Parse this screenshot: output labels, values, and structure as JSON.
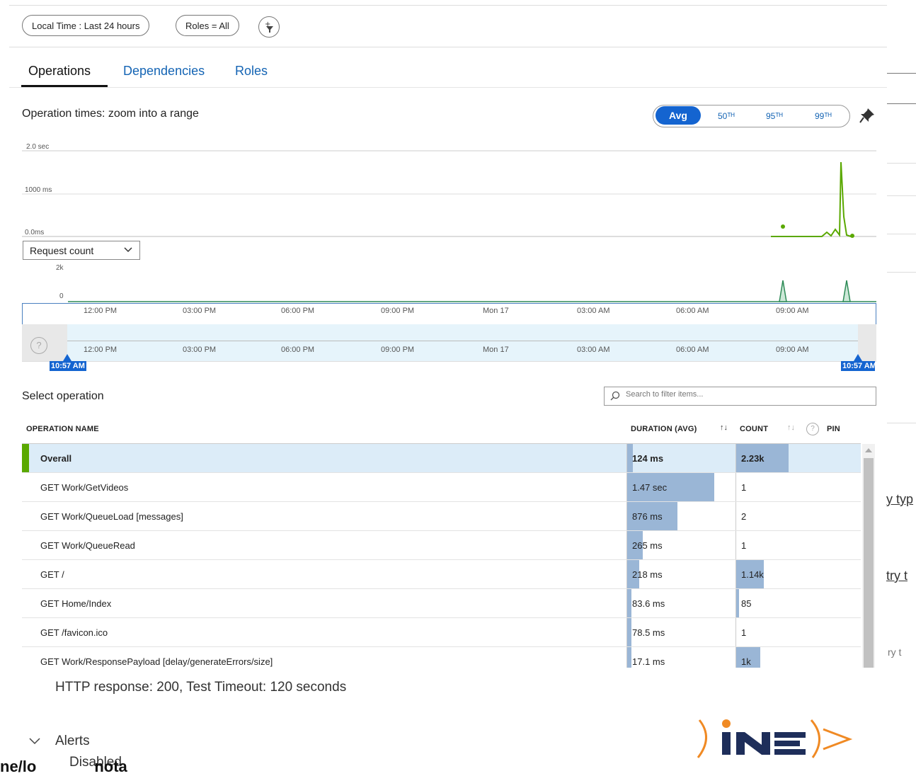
{
  "filters": {
    "time": "Local Time : Last 24 hours",
    "roles": "Roles = All",
    "add_filter_icon": "add-filter-icon"
  },
  "tabs": [
    "Operations",
    "Dependencies",
    "Roles"
  ],
  "chart_title": "Operation times: zoom into a range",
  "percentile": {
    "avg": "Avg",
    "p50": "50ᵀᴴ",
    "p95": "95ᵀᴴ",
    "p99": "99ᵀᴴ"
  },
  "chart_data": [
    {
      "type": "line",
      "ylabel_ticks": [
        "2.0 sec",
        "1000 ms",
        "0.0ms"
      ],
      "ylim": [
        0,
        2000
      ],
      "series": [
        {
          "values_ms": [
            0,
            0,
            0,
            50,
            80,
            30,
            1750,
            0
          ]
        }
      ]
    },
    {
      "type": "area",
      "ylabel_ticks": [
        "2k",
        "0"
      ],
      "ylim": [
        0,
        2000
      ],
      "series": [
        {
          "values": [
            0,
            0,
            1400,
            0,
            0,
            1500,
            0
          ]
        }
      ]
    }
  ],
  "metric_select": "Request count",
  "time_ticks": [
    "12:00 PM",
    "03:00 PM",
    "06:00 PM",
    "09:00 PM",
    "Mon 17",
    "03:00 AM",
    "06:00 AM",
    "09:00 AM"
  ],
  "range": {
    "start": "10:57 AM",
    "end": "10:57 AM"
  },
  "select_operation": "Select operation",
  "search_placeholder": "Search to filter items...",
  "columns": {
    "name": "OPERATION NAME",
    "duration": "DURATION (AVG)",
    "count": "COUNT",
    "pin": "PIN"
  },
  "rows": [
    {
      "name": "Overall",
      "duration": "124 ms",
      "duration_fraction": 0.05,
      "count": "2.23k",
      "count_fraction": 0.42
    },
    {
      "name": "GET Work/GetVideos",
      "duration": "1.47 sec",
      "duration_fraction": 0.8,
      "count": "1",
      "count_fraction": 0
    },
    {
      "name": "GET Work/QueueLoad [messages]",
      "duration": "876 ms",
      "duration_fraction": 0.46,
      "count": "2",
      "count_fraction": 0
    },
    {
      "name": "GET Work/QueueRead",
      "duration": "265 ms",
      "duration_fraction": 0.14,
      "count": "1",
      "count_fraction": 0
    },
    {
      "name": "GET /",
      "duration": "218 ms",
      "duration_fraction": 0.11,
      "count": "1.14k",
      "count_fraction": 0.22
    },
    {
      "name": "GET Home/Index",
      "duration": "83.6 ms",
      "duration_fraction": 0.04,
      "count": "85",
      "count_fraction": 0.02
    },
    {
      "name": "GET /favicon.ico",
      "duration": "78.5 ms",
      "duration_fraction": 0.04,
      "count": "1",
      "count_fraction": 0
    },
    {
      "name": "GET Work/ResponsePayload [delay/generateErrors/size]",
      "duration": "17.1 ms",
      "duration_fraction": 0.01,
      "count": "1k",
      "count_fraction": 0.19
    }
  ],
  "side_fragments": [
    "y typ",
    "try t",
    "ry t"
  ],
  "footer": {
    "http": "HTTP response: 200, Test Timeout: 120 seconds",
    "alerts": "Alerts",
    "disabled": "Disabled",
    "overlap": "ne/lo",
    "overlap2": "nota",
    "logo": "INE"
  }
}
